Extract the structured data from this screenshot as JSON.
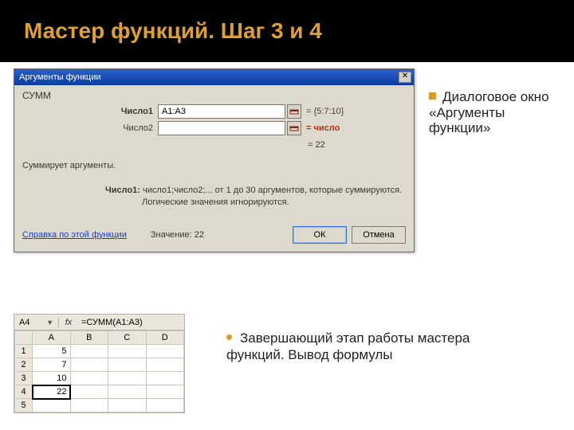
{
  "slide": {
    "title": "Мастер функций. Шаг 3 и 4"
  },
  "dialog": {
    "title": "Аргументы функции",
    "function_name": "СУММ",
    "arg1_label": "Число1",
    "arg1_value": "A1:A3",
    "arg1_hint": "= {5:7:10}",
    "arg2_label": "Число2",
    "arg2_value": "",
    "arg2_hint": "число",
    "equals_result": "= 22",
    "description": "Суммирует аргументы.",
    "arg_explanation_label": "Число1:",
    "arg_explanation": "число1;число2;... от 1 до 30 аргументов, которые суммируются. Логические значения игнорируются.",
    "help_link": "Справка по этой функции",
    "value_label": "Значение:",
    "value": "22",
    "ok": "ОК",
    "cancel": "Отмена"
  },
  "side_bullet": "Диалоговое окно «Аргументы функции»",
  "lower_bullet": "Завершающий этап работы мастера функций. Вывод формулы",
  "sheet": {
    "namebox": "A4",
    "fx": "fx",
    "formula": "=СУММ(A1:A3)",
    "cols": [
      "",
      "A",
      "B",
      "C",
      "D"
    ],
    "rows": [
      {
        "n": "1",
        "a": "5"
      },
      {
        "n": "2",
        "a": "7"
      },
      {
        "n": "3",
        "a": "10"
      },
      {
        "n": "4",
        "a": "22",
        "selected": true
      },
      {
        "n": "5",
        "a": ""
      }
    ]
  }
}
